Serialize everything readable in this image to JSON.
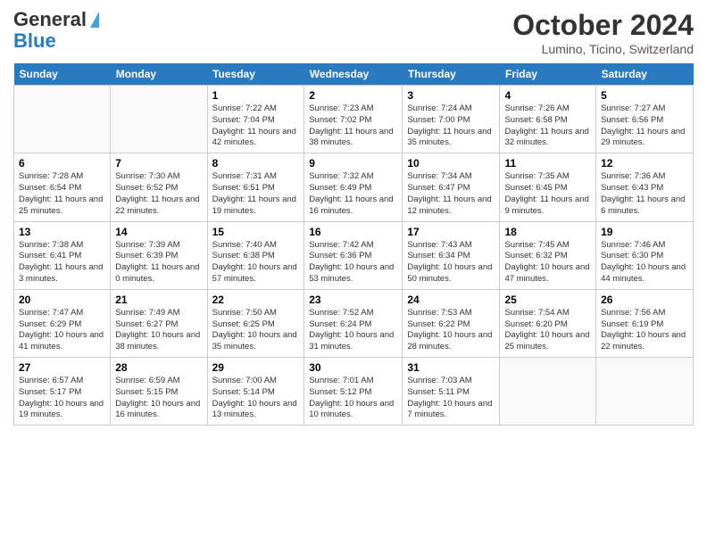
{
  "header": {
    "logo_line1": "General",
    "logo_line2": "Blue",
    "month_title": "October 2024",
    "location": "Lumino, Ticino, Switzerland"
  },
  "days_of_week": [
    "Sunday",
    "Monday",
    "Tuesday",
    "Wednesday",
    "Thursday",
    "Friday",
    "Saturday"
  ],
  "weeks": [
    [
      {
        "day": "",
        "info": ""
      },
      {
        "day": "",
        "info": ""
      },
      {
        "day": "1",
        "info": "Sunrise: 7:22 AM\nSunset: 7:04 PM\nDaylight: 11 hours and 42 minutes."
      },
      {
        "day": "2",
        "info": "Sunrise: 7:23 AM\nSunset: 7:02 PM\nDaylight: 11 hours and 38 minutes."
      },
      {
        "day": "3",
        "info": "Sunrise: 7:24 AM\nSunset: 7:00 PM\nDaylight: 11 hours and 35 minutes."
      },
      {
        "day": "4",
        "info": "Sunrise: 7:26 AM\nSunset: 6:58 PM\nDaylight: 11 hours and 32 minutes."
      },
      {
        "day": "5",
        "info": "Sunrise: 7:27 AM\nSunset: 6:56 PM\nDaylight: 11 hours and 29 minutes."
      }
    ],
    [
      {
        "day": "6",
        "info": "Sunrise: 7:28 AM\nSunset: 6:54 PM\nDaylight: 11 hours and 25 minutes."
      },
      {
        "day": "7",
        "info": "Sunrise: 7:30 AM\nSunset: 6:52 PM\nDaylight: 11 hours and 22 minutes."
      },
      {
        "day": "8",
        "info": "Sunrise: 7:31 AM\nSunset: 6:51 PM\nDaylight: 11 hours and 19 minutes."
      },
      {
        "day": "9",
        "info": "Sunrise: 7:32 AM\nSunset: 6:49 PM\nDaylight: 11 hours and 16 minutes."
      },
      {
        "day": "10",
        "info": "Sunrise: 7:34 AM\nSunset: 6:47 PM\nDaylight: 11 hours and 12 minutes."
      },
      {
        "day": "11",
        "info": "Sunrise: 7:35 AM\nSunset: 6:45 PM\nDaylight: 11 hours and 9 minutes."
      },
      {
        "day": "12",
        "info": "Sunrise: 7:36 AM\nSunset: 6:43 PM\nDaylight: 11 hours and 6 minutes."
      }
    ],
    [
      {
        "day": "13",
        "info": "Sunrise: 7:38 AM\nSunset: 6:41 PM\nDaylight: 11 hours and 3 minutes."
      },
      {
        "day": "14",
        "info": "Sunrise: 7:39 AM\nSunset: 6:39 PM\nDaylight: 11 hours and 0 minutes."
      },
      {
        "day": "15",
        "info": "Sunrise: 7:40 AM\nSunset: 6:38 PM\nDaylight: 10 hours and 57 minutes."
      },
      {
        "day": "16",
        "info": "Sunrise: 7:42 AM\nSunset: 6:36 PM\nDaylight: 10 hours and 53 minutes."
      },
      {
        "day": "17",
        "info": "Sunrise: 7:43 AM\nSunset: 6:34 PM\nDaylight: 10 hours and 50 minutes."
      },
      {
        "day": "18",
        "info": "Sunrise: 7:45 AM\nSunset: 6:32 PM\nDaylight: 10 hours and 47 minutes."
      },
      {
        "day": "19",
        "info": "Sunrise: 7:46 AM\nSunset: 6:30 PM\nDaylight: 10 hours and 44 minutes."
      }
    ],
    [
      {
        "day": "20",
        "info": "Sunrise: 7:47 AM\nSunset: 6:29 PM\nDaylight: 10 hours and 41 minutes."
      },
      {
        "day": "21",
        "info": "Sunrise: 7:49 AM\nSunset: 6:27 PM\nDaylight: 10 hours and 38 minutes."
      },
      {
        "day": "22",
        "info": "Sunrise: 7:50 AM\nSunset: 6:25 PM\nDaylight: 10 hours and 35 minutes."
      },
      {
        "day": "23",
        "info": "Sunrise: 7:52 AM\nSunset: 6:24 PM\nDaylight: 10 hours and 31 minutes."
      },
      {
        "day": "24",
        "info": "Sunrise: 7:53 AM\nSunset: 6:22 PM\nDaylight: 10 hours and 28 minutes."
      },
      {
        "day": "25",
        "info": "Sunrise: 7:54 AM\nSunset: 6:20 PM\nDaylight: 10 hours and 25 minutes."
      },
      {
        "day": "26",
        "info": "Sunrise: 7:56 AM\nSunset: 6:19 PM\nDaylight: 10 hours and 22 minutes."
      }
    ],
    [
      {
        "day": "27",
        "info": "Sunrise: 6:57 AM\nSunset: 5:17 PM\nDaylight: 10 hours and 19 minutes."
      },
      {
        "day": "28",
        "info": "Sunrise: 6:59 AM\nSunset: 5:15 PM\nDaylight: 10 hours and 16 minutes."
      },
      {
        "day": "29",
        "info": "Sunrise: 7:00 AM\nSunset: 5:14 PM\nDaylight: 10 hours and 13 minutes."
      },
      {
        "day": "30",
        "info": "Sunrise: 7:01 AM\nSunset: 5:12 PM\nDaylight: 10 hours and 10 minutes."
      },
      {
        "day": "31",
        "info": "Sunrise: 7:03 AM\nSunset: 5:11 PM\nDaylight: 10 hours and 7 minutes."
      },
      {
        "day": "",
        "info": ""
      },
      {
        "day": "",
        "info": ""
      }
    ]
  ]
}
